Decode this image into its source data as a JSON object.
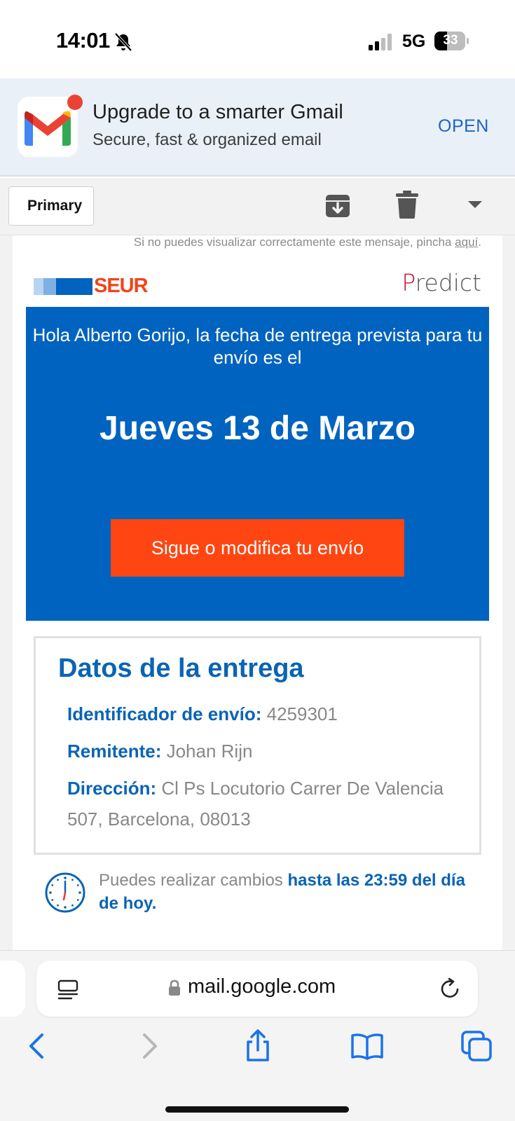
{
  "status_bar": {
    "time": "14:01",
    "network": "5G",
    "battery": "33"
  },
  "gmail_banner": {
    "title": "Upgrade to a smarter Gmail",
    "subtitle": "Secure, fast & organized email",
    "open_label": "OPEN"
  },
  "toolbar": {
    "back_label": "Primary"
  },
  "email": {
    "preheader_text": "Si no puedes visualizar correctamente este mensaje, pincha ",
    "preheader_link": "aquí",
    "preheader_end": ".",
    "brand": "SEUR",
    "product_first": "P",
    "product_rest": "redict",
    "greeting": "Hola Alberto Gorijo, la fecha de entrega prevista para tu envío es el",
    "delivery_date": "Jueves 13 de Marzo",
    "cta_label": "Sigue o modifica tu envío",
    "details_title": "Datos de la entrega",
    "details": [
      {
        "label": "Identificador de envío:",
        "value": "4259301"
      },
      {
        "label": "Remitente:",
        "value": "Johan Rijn"
      },
      {
        "label": "Dirección:",
        "value": "Cl Ps Locutorio Carrer De Valencia 507, Barcelona, 08013"
      }
    ],
    "deadline_text": "Puedes realizar cambios ",
    "deadline_strong": "hasta las 23:59 del día de hoy."
  },
  "browser": {
    "url": "mail.google.com"
  },
  "colors": {
    "seur_blue": "#0063bf",
    "seur_orange": "#ff4612",
    "gmail_open": "#1a65c8"
  }
}
